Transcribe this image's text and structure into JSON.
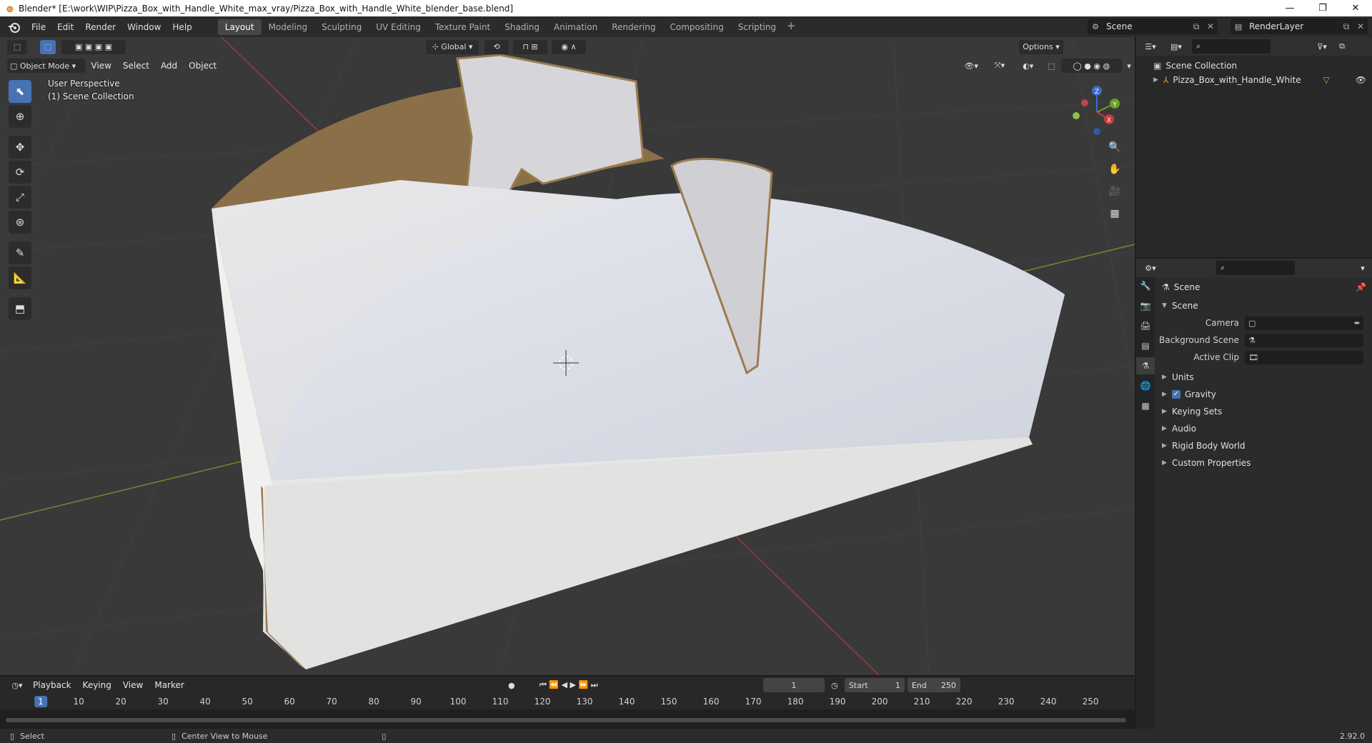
{
  "window": {
    "title": "Blender* [E:\\work\\WIP\\Pizza_Box_with_Handle_White_max_vray/Pizza_Box_with_Handle_White_blender_base.blend]",
    "minimize": "—",
    "maximize": "❐",
    "close": "✕"
  },
  "menu": [
    "File",
    "Edit",
    "Render",
    "Window",
    "Help"
  ],
  "workspaces": [
    "Layout",
    "Modeling",
    "Sculpting",
    "UV Editing",
    "Texture Paint",
    "Shading",
    "Animation",
    "Rendering",
    "Compositing",
    "Scripting"
  ],
  "workspace_add": "+",
  "scene": {
    "name": "Scene",
    "view_layer": "RenderLayer"
  },
  "viewport": {
    "mode": "Object Mode",
    "header_menus": [
      "View",
      "Select",
      "Add",
      "Object"
    ],
    "transform_orientation": "Global",
    "options_label": "Options",
    "overlay_title": "User Perspective",
    "overlay_subtitle": "(1) Scene Collection",
    "gizmo_axes": {
      "z": "Z",
      "y": "Y",
      "x": "X"
    },
    "colors": {
      "background": "#393939",
      "grid": "#404040",
      "x_axis": "#9a3b3b",
      "y_axis": "#6a8e2e",
      "box_white": "#eeeeee",
      "cardboard": "#8a6f48"
    }
  },
  "outliner": {
    "root": "Scene Collection",
    "items": [
      {
        "name": "Pizza_Box_with_Handle_White"
      }
    ]
  },
  "properties": {
    "context": "Scene",
    "panel_title": "Scene",
    "fields": [
      {
        "label": "Camera",
        "value": ""
      },
      {
        "label": "Background Scene",
        "value": ""
      },
      {
        "label": "Active Clip",
        "value": ""
      }
    ],
    "panels": [
      {
        "label": "Units",
        "checkbox": false
      },
      {
        "label": "Gravity",
        "checkbox": true
      },
      {
        "label": "Keying Sets",
        "checkbox": false
      },
      {
        "label": "Audio",
        "checkbox": false
      },
      {
        "label": "Rigid Body World",
        "checkbox": false
      },
      {
        "label": "Custom Properties",
        "checkbox": false
      }
    ]
  },
  "timeline": {
    "menus": [
      "Playback",
      "Keying",
      "View",
      "Marker"
    ],
    "current_frame": "1",
    "start_label": "Start",
    "start": "1",
    "end_label": "End",
    "end": "250",
    "ruler": [
      "1",
      "10",
      "20",
      "30",
      "40",
      "50",
      "60",
      "70",
      "80",
      "90",
      "100",
      "110",
      "120",
      "130",
      "140",
      "150",
      "160",
      "170",
      "180",
      "190",
      "200",
      "210",
      "220",
      "230",
      "240",
      "250"
    ]
  },
  "statusbar": {
    "left_action": "Select",
    "middle_action": "Center View to Mouse",
    "version": "2.92.0"
  }
}
